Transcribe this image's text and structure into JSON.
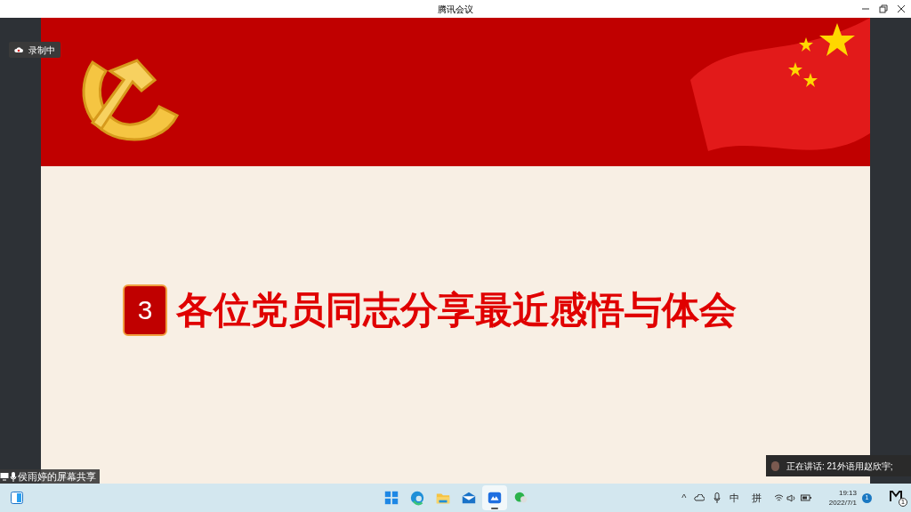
{
  "window": {
    "title": "腾讯会议"
  },
  "recording": {
    "label": "录制中"
  },
  "slide": {
    "number": "3",
    "title": "各位党员同志分享最近感悟与体会"
  },
  "share_label": "侯雨婷的屏幕共享",
  "speaker": {
    "text": "正在讲话: 21外语用赵欣宇;"
  },
  "taskbar": {
    "apps": [
      {
        "kind": "start",
        "selected": false
      },
      {
        "kind": "browser",
        "selected": false
      },
      {
        "kind": "folder",
        "selected": false
      },
      {
        "kind": "mail",
        "selected": false
      },
      {
        "kind": "meeting",
        "selected": true
      },
      {
        "kind": "chat",
        "selected": false
      }
    ],
    "tray": {
      "chevron": "^",
      "ime_mode": "中",
      "ime": "拼",
      "time": "19:13",
      "date": "2022/7/1",
      "notifications": "1",
      "corner_badge": "1"
    }
  }
}
